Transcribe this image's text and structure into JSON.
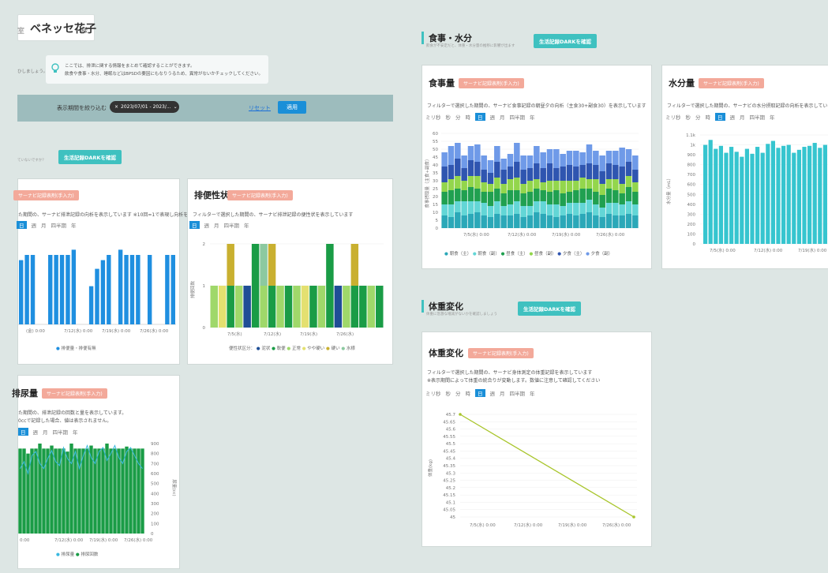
{
  "header": {
    "tab_fragment": "室",
    "name": "ベネッセ花子",
    "honorific": "様"
  },
  "info": {
    "left_fragment": "ひしましょう。",
    "line1": "ここでは、排泄に関する情報をまとめて確認することができます。",
    "line2": "飲食や食事・水分、睡眠などはBPSDの要因にもなりうるため、異常がないかチェックしてください。"
  },
  "filter": {
    "label": "表示期間を絞り込む",
    "value": "2023/07/01 - 2023/...",
    "reset": "リセット",
    "apply": "適用"
  },
  "left_section": {
    "sub_fragment": "ていないですか？",
    "dark_button": "生活記録DARKを確認"
  },
  "common": {
    "tag": "サーナビ記録表剤(手入力)"
  },
  "excretion_card": {
    "desc": "た期間の、サーナビ排泄記録の向析を表示しています ※10回=1で表現し向析を表示",
    "periods": [
      "日",
      "週",
      "月",
      "四半期",
      "年"
    ],
    "active": "日",
    "xticks": [
      "(金) 0:00",
      "7/12(水) 0:00",
      "7/19(水) 0:00",
      "7/26(水) 0:00"
    ],
    "legend": "排便量・排便有無"
  },
  "stool_card": {
    "title": "排便性状",
    "desc": "フィルターで選択した期間の、サーナビ排泄記録の便性状を表示しています",
    "periods": [
      "日",
      "週",
      "月",
      "四半期",
      "年"
    ],
    "active": "日",
    "yticks": [
      "2",
      "1",
      "0"
    ],
    "ylabel": "排便回数",
    "xticks": [
      "7/5(水)",
      "7/12(水)",
      "7/19(水)",
      "7/26(水)"
    ],
    "legend_prefix": "便性状区分：",
    "legend": [
      "泥状",
      "軟便",
      "正常",
      "やや硬い",
      "硬い",
      "水様"
    ]
  },
  "urine_card": {
    "title": "排尿量",
    "desc1": "た期間の、排泄記録の回数と量を表示しています。",
    "desc2": "0ccで記録した場合、値は表示されません。",
    "periods": [
      "日",
      "週",
      "月",
      "四半期",
      "年"
    ],
    "active": "日",
    "yticks": [
      "900",
      "800",
      "700",
      "600",
      "500",
      "400",
      "300",
      "200",
      "100",
      "0"
    ],
    "ylabel": "尿量(cc)",
    "xticks": [
      "0:00",
      "7/12(水) 0:00",
      "7/19(水) 0:00",
      "7/26(水) 0:00"
    ],
    "legend": [
      "排尿量",
      "排尿回数"
    ]
  },
  "meal_section": {
    "title": "食事・水分",
    "sub": "飲食が不安定だと、体重・水分量の推移に影響が出ます",
    "dark_button": "生活記録DARKを確認"
  },
  "meal_card": {
    "title": "食事量",
    "desc": "フィルターで選択した期間の、サーナビ食事記録の朝昼夕の向析（主食30+副食30）を表示しています",
    "periods": [
      "ミリ秒",
      "秒",
      "分",
      "時",
      "日",
      "週",
      "月",
      "四半期",
      "年"
    ],
    "active": "日",
    "yticks": [
      "60",
      "55",
      "50",
      "45",
      "40",
      "35",
      "30",
      "25",
      "20",
      "15",
      "10",
      "5",
      "0"
    ],
    "ylabel": "食事摂取量（主食+副食）",
    "xticks": [
      "7/5(水) 0:00",
      "7/12(水) 0:00",
      "7/19(水) 0:00",
      "7/26(水) 0:00"
    ],
    "legend": [
      "朝食（主）",
      "朝食（副）",
      "昼食（主）",
      "昼食（副）",
      "夕食（主）",
      "夕食（副）"
    ]
  },
  "water_card": {
    "title": "水分量",
    "desc": "フィルターで選択した期間の、サーナビの水分摂取記録の向析を表示しています",
    "periods": [
      "ミリ秒",
      "秒",
      "分",
      "時",
      "日",
      "週",
      "月",
      "四半期",
      "年"
    ],
    "active": "日",
    "yticks": [
      "1.1k",
      "1k",
      "900",
      "800",
      "700",
      "600",
      "500",
      "400",
      "300",
      "200",
      "100",
      "0"
    ],
    "ylabel": "水分量（mL）",
    "xticks": [
      "7/5(水) 0:00",
      "7/12(水) 0:00",
      "7/19(水) 0:00"
    ]
  },
  "weight_section": {
    "title": "体重変化",
    "sub": "体重に急激な増減がないかを確認しましょう",
    "dark_button": "生活記録DARKを確認"
  },
  "weight_card": {
    "title": "体重変化",
    "desc1": "フィルターで選択した期間の、サーナビ身体測定の体重記録を表示しています",
    "desc2": "※表示期間によって体重の統合りが変動します。数値に注意して確認してください",
    "periods": [
      "ミリ秒",
      "秒",
      "分",
      "時",
      "日",
      "週",
      "月",
      "四半期",
      "年"
    ],
    "active": "日",
    "yticks": [
      "45.7",
      "45.65",
      "45.6",
      "45.55",
      "45.5",
      "45.45",
      "45.4",
      "45.35",
      "45.3",
      "45.25",
      "45.2",
      "45.15",
      "45.1",
      "45.05",
      "45"
    ],
    "ylabel": "体重(kg)",
    "xticks": [
      "7/5(水) 0:00",
      "7/12(水) 0:00",
      "7/19(水) 0:00",
      "7/26(水) 0:00"
    ]
  },
  "chart_data": [
    {
      "type": "bar",
      "id": "excretion",
      "ylim": [
        0,
        5
      ],
      "values": [
        3.7,
        4.0,
        4.0,
        0,
        0,
        4.0,
        4.0,
        4.0,
        4.0,
        4.3,
        0,
        0,
        2.2,
        3.2,
        3.7,
        4.0,
        0,
        4.3,
        4.0,
        4.0,
        4.0,
        0,
        4.0,
        0,
        0,
        4.0,
        4.0
      ],
      "legend": [
        "排便量・排便有無"
      ]
    },
    {
      "type": "bar",
      "id": "stool",
      "ylim": [
        0,
        2
      ],
      "series": [
        {
          "name": "泥状",
          "color": "#1f4e96"
        },
        {
          "name": "軟便",
          "color": "#1a9c46"
        },
        {
          "name": "正常",
          "color": "#9fd86a"
        },
        {
          "name": "やや硬い",
          "color": "#e4e070"
        },
        {
          "name": "硬い",
          "color": "#c9b030"
        },
        {
          "name": "水様",
          "color": "#8cc9a0"
        }
      ],
      "columns": [
        [
          [
            "正常",
            1
          ]
        ],
        [
          [
            "やや硬い",
            1
          ]
        ],
        [
          [
            "軟便",
            1
          ],
          [
            "硬い",
            1
          ]
        ],
        [
          [
            "正常",
            1
          ]
        ],
        [
          [
            "泥状",
            1
          ]
        ],
        [
          [
            "軟便",
            2
          ]
        ],
        [
          [
            "正常",
            1
          ],
          [
            "水様",
            1
          ]
        ],
        [
          [
            "軟便",
            1
          ],
          [
            "硬い",
            1
          ]
        ],
        [
          [
            "正常",
            1
          ]
        ],
        [
          [
            "軟便",
            1
          ]
        ],
        [
          [
            "正常",
            1
          ]
        ],
        [
          [
            "やや硬い",
            1
          ]
        ],
        [
          [
            "軟便",
            1
          ]
        ],
        [
          [
            "正常",
            1
          ]
        ],
        [
          [
            "軟便",
            2
          ]
        ],
        [
          [
            "泥状",
            1
          ]
        ],
        [
          [
            "正常",
            1
          ]
        ],
        [
          [
            "軟便",
            1
          ],
          [
            "硬い",
            1
          ]
        ],
        [
          [
            "軟便",
            1
          ]
        ],
        [
          [
            "正常",
            1
          ]
        ],
        [
          [
            "軟便",
            1
          ]
        ]
      ]
    },
    {
      "type": "bar",
      "id": "urine",
      "ylim": [
        0,
        900
      ],
      "values": [
        850,
        850,
        800,
        850,
        850,
        900,
        850,
        850,
        880,
        850,
        850,
        850,
        820,
        900,
        850,
        850,
        850,
        850,
        880,
        850,
        850,
        850,
        900,
        850,
        850,
        850,
        850,
        870,
        850,
        850,
        850,
        850
      ],
      "line": [
        650,
        720,
        600,
        780,
        820,
        700,
        650,
        750,
        830,
        720,
        680,
        860,
        750,
        700,
        820,
        650,
        780,
        880,
        760,
        700,
        820,
        860,
        730,
        800,
        880,
        760,
        700,
        820,
        860,
        780,
        700,
        650
      ],
      "legend": [
        "排尿量",
        "排尿回数"
      ]
    },
    {
      "type": "bar",
      "id": "meal",
      "ylim": [
        0,
        60
      ],
      "stacked": true,
      "series": [
        {
          "name": "朝食（主）",
          "color": "#2ba8b8"
        },
        {
          "name": "朝食（副）",
          "color": "#63d6d6"
        },
        {
          "name": "昼食（主）",
          "color": "#20a050"
        },
        {
          "name": "昼食（副）",
          "color": "#93d64c"
        },
        {
          "name": "夕食（主）",
          "color": "#2f55b0"
        },
        {
          "name": "夕食（副）",
          "color": "#6f9ae8"
        }
      ],
      "values": [
        [
          8,
          7,
          10,
          8,
          9,
          10,
          8,
          7,
          9,
          8,
          8,
          9,
          7,
          8,
          10,
          9,
          8,
          7,
          8,
          9,
          8,
          9,
          10,
          8,
          7,
          9,
          8,
          8,
          9,
          8
        ],
        [
          7,
          8,
          7,
          9,
          8,
          7,
          8,
          7,
          8,
          6,
          7,
          8,
          7,
          6,
          7,
          8,
          7,
          8,
          6,
          7,
          8,
          7,
          8,
          7,
          6,
          7,
          8,
          7,
          8,
          7
        ],
        [
          8,
          9,
          8,
          7,
          9,
          8,
          7,
          9,
          8,
          8,
          9,
          7,
          8,
          9,
          8,
          7,
          8,
          9,
          8,
          7,
          8,
          9,
          7,
          8,
          8,
          9,
          8,
          7,
          9,
          8
        ],
        [
          6,
          7,
          8,
          6,
          7,
          8,
          6,
          5,
          7,
          6,
          7,
          8,
          6,
          7,
          6,
          5,
          7,
          6,
          8,
          7,
          6,
          7,
          6,
          8,
          7,
          6,
          7,
          6,
          7,
          6
        ],
        [
          10,
          9,
          11,
          8,
          10,
          9,
          8,
          7,
          10,
          9,
          8,
          10,
          9,
          8,
          10,
          9,
          11,
          8,
          9,
          10,
          9,
          8,
          10,
          9,
          8,
          10,
          9,
          11,
          9,
          8
        ],
        [
          9,
          12,
          10,
          8,
          9,
          11,
          9,
          8,
          10,
          7,
          8,
          12,
          9,
          8,
          11,
          10,
          9,
          12,
          8,
          9,
          10,
          8,
          12,
          9,
          10,
          8,
          9,
          12,
          8,
          9
        ]
      ]
    },
    {
      "type": "bar",
      "id": "water",
      "ylim": [
        0,
        1100
      ],
      "values": [
        1000,
        1050,
        960,
        990,
        920,
        980,
        930,
        880,
        960,
        910,
        980,
        920,
        1010,
        1040,
        970,
        990,
        1000,
        920,
        950,
        980,
        990,
        1020,
        970,
        1000,
        1040,
        960,
        990,
        1050
      ]
    },
    {
      "type": "line",
      "id": "weight",
      "ylim": [
        45,
        45.7
      ],
      "x": [
        "7/1",
        "7/31"
      ],
      "values": [
        45.7,
        45.0
      ]
    }
  ]
}
